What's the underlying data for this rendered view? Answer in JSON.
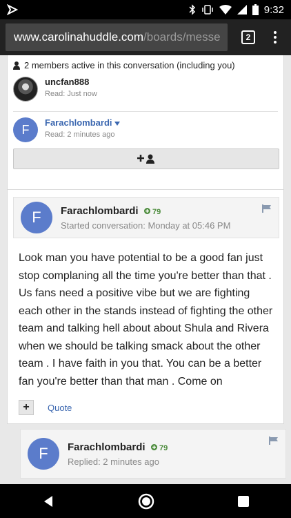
{
  "status_bar": {
    "time": "9:32"
  },
  "browser": {
    "url_host": "www.carolinahuddle.com",
    "url_path": "/boards/messe",
    "tab_count": "2"
  },
  "members": {
    "header": "2 members active in this conversation (including you)",
    "list": [
      {
        "name": "uncfan888",
        "read": "Read: Just now"
      },
      {
        "name": "Farachlombardi",
        "read": "Read: 2 minutes ago",
        "avatar_letter": "F"
      }
    ]
  },
  "posts": [
    {
      "author": "Farachlombardi",
      "rep": "79",
      "avatar_letter": "F",
      "meta": "Started conversation: Monday at 05:46 PM",
      "body": "Look man you have potential to be a good fan just stop complaning all the time you're better than that . Us fans need a positive vibe but we are fighting each other in the stands instead of fighting the other team and talking hell about about Shula and Rivera when we should be talking smack about the other team .  I have faith in you that. You can be a better fan you're better than that man . Come on",
      "quote_label": "Quote"
    },
    {
      "author": "Farachlombardi",
      "rep": "79",
      "avatar_letter": "F",
      "meta": "Replied: 2 minutes ago"
    }
  ]
}
